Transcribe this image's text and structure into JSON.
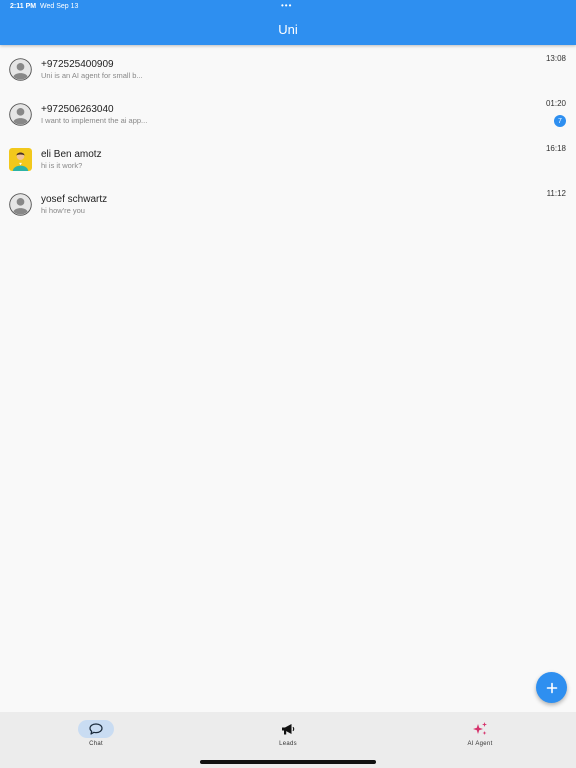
{
  "status_bar": {
    "time": "2:11 PM",
    "date": "Wed Sep 13",
    "dots": "•••"
  },
  "header": {
    "title": "Uni"
  },
  "chats": [
    {
      "name": "+972525400909",
      "preview": "Uni is an AI agent for small b...",
      "time": "13:08",
      "avatar": "default-person-icon",
      "unread": ""
    },
    {
      "name": "+972506263040",
      "preview": "I want to implement the ai app...",
      "time": "01:20",
      "avatar": "default-person-icon",
      "unread": "7"
    },
    {
      "name": "eli Ben amotz",
      "preview": "hi is it work?",
      "time": "16:18",
      "avatar": "photo-avatar",
      "unread": ""
    },
    {
      "name": "yosef schwartz",
      "preview": "hi how're you",
      "time": "11:12",
      "avatar": "default-person-icon",
      "unread": ""
    }
  ],
  "fab": {
    "icon": "plus-icon"
  },
  "bottom_nav": {
    "items": [
      {
        "label": "Chat",
        "icon": "chat-bubble-icon",
        "active": true
      },
      {
        "label": "Leads",
        "icon": "megaphone-icon",
        "active": false
      },
      {
        "label": "AI Agent",
        "icon": "sparkles-icon",
        "active": false
      }
    ]
  },
  "colors": {
    "primary": "#2e8ff0",
    "background": "#f9f9f9",
    "nav_background": "#ececec",
    "active_pill": "#c9dcf2",
    "sparkle": "#d6336c"
  }
}
